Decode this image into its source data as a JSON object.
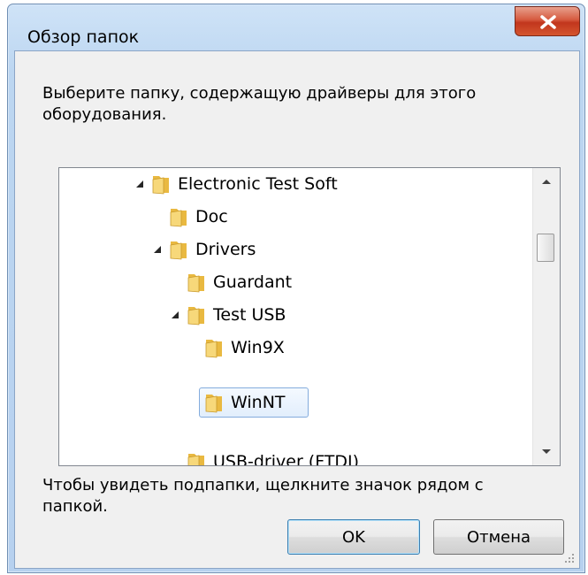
{
  "window": {
    "title": "Обзор папок"
  },
  "description": "Выберите папку, содержащую драйверы для этого оборудования.",
  "tree": {
    "items": [
      {
        "label": "Electronic Test Soft",
        "expanded": true,
        "has_expander": true
      },
      {
        "label": "Doc",
        "expanded": false,
        "has_expander": false
      },
      {
        "label": "Drivers",
        "expanded": true,
        "has_expander": true
      },
      {
        "label": "Guardant",
        "expanded": false,
        "has_expander": false
      },
      {
        "label": "Test USB",
        "expanded": true,
        "has_expander": true
      },
      {
        "label": "Win9X",
        "expanded": false,
        "has_expander": false
      },
      {
        "label": "WinNT",
        "expanded": false,
        "has_expander": false,
        "selected": true
      },
      {
        "label": "USB-driver (FTDI)",
        "expanded": false,
        "has_expander": false
      }
    ]
  },
  "hint": "Чтобы увидеть подпапки, щелкните значок рядом с папкой.",
  "buttons": {
    "ok": "OK",
    "cancel": "Отмена"
  },
  "icons": {
    "close": "close-icon",
    "folder": "folder-icon",
    "expander": "expanded-triangle-icon",
    "scroll_up": "scroll-up-arrow-icon",
    "scroll_down": "scroll-down-arrow-icon",
    "resize": "resize-grip-icon"
  },
  "colors": {
    "close_button": "#c2361d",
    "selection_border": "#84acdd",
    "titlebar": "#bcd6f1"
  }
}
